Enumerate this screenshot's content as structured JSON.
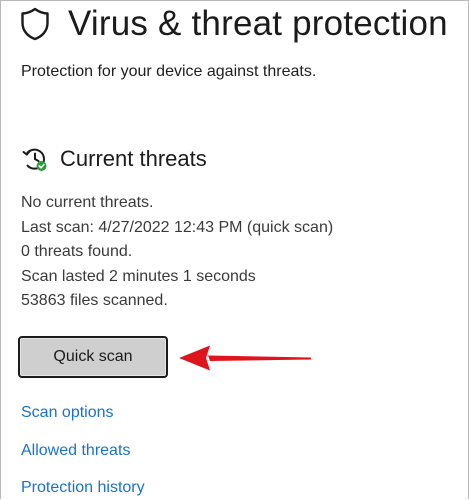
{
  "page": {
    "title": "Virus & threat protection",
    "subtitle": "Protection for your device against threats."
  },
  "icons": {
    "header": "shield-icon",
    "section": "threat-scan-icon"
  },
  "colors": {
    "link": "#1a73c8",
    "annotation_arrow": "#e0141c",
    "status_ok": "#2a9d3a",
    "button_bg": "#cfcfcf"
  },
  "current_threats": {
    "heading": "Current threats",
    "status": "No current threats.",
    "last_scan": "Last scan: 4/27/2022 12:43 PM (quick scan)",
    "threats_found": "0 threats found.",
    "duration": "Scan lasted 2 minutes 1 seconds",
    "files_scanned": "53863 files scanned."
  },
  "actions": {
    "quick_scan_label": "Quick scan"
  },
  "links": {
    "scan_options": "Scan options",
    "allowed_threats": "Allowed threats",
    "protection_history": "Protection history"
  }
}
